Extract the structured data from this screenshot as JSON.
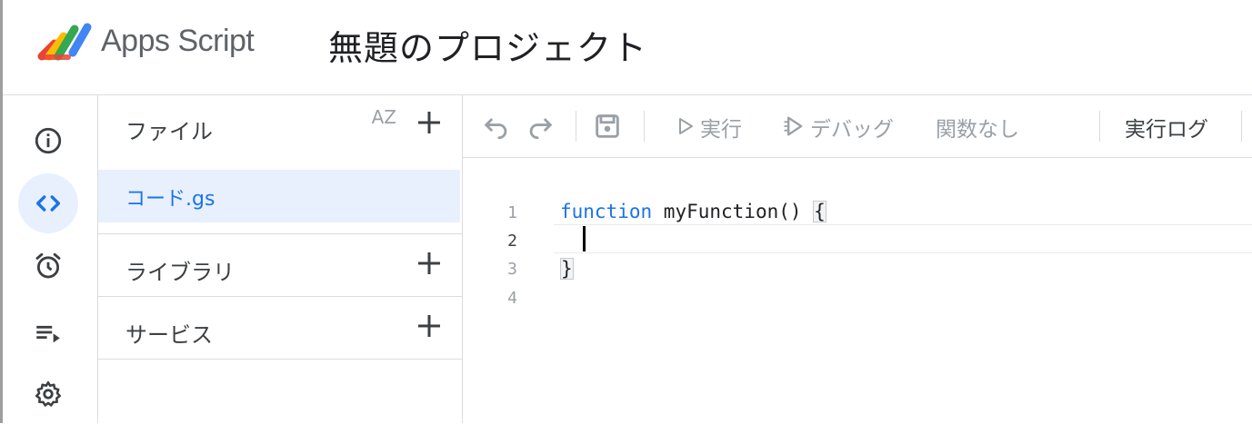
{
  "header": {
    "app_name": "Apps Script",
    "project_title": "無題のプロジェクト"
  },
  "rail": {
    "items": [
      {
        "icon": "info-icon",
        "active": false
      },
      {
        "icon": "code-icon",
        "active": true
      },
      {
        "icon": "alarm-clock-icon",
        "active": false
      },
      {
        "icon": "executions-icon",
        "active": false
      },
      {
        "icon": "gear-icon",
        "active": false
      }
    ]
  },
  "files_panel": {
    "files_label": "ファイル",
    "sort_label": "AZ",
    "files": [
      {
        "name": "コード.gs",
        "selected": true
      }
    ],
    "libraries_label": "ライブラリ",
    "services_label": "サービス"
  },
  "toolbar": {
    "run_label": "実行",
    "debug_label": "デバッグ",
    "function_label": "関数なし",
    "log_label": "実行ログ"
  },
  "editor": {
    "line_numbers": [
      "1",
      "2",
      "3",
      "4"
    ],
    "current_line": 2,
    "lines": {
      "l1_keyword": "function",
      "l1_rest": " myFunction() ",
      "l1_brace": "{",
      "l3_brace": "}"
    }
  },
  "colors": {
    "accent": "#1a73e8",
    "selected_bg": "#e8f0fe",
    "divider": "#dadce0"
  }
}
